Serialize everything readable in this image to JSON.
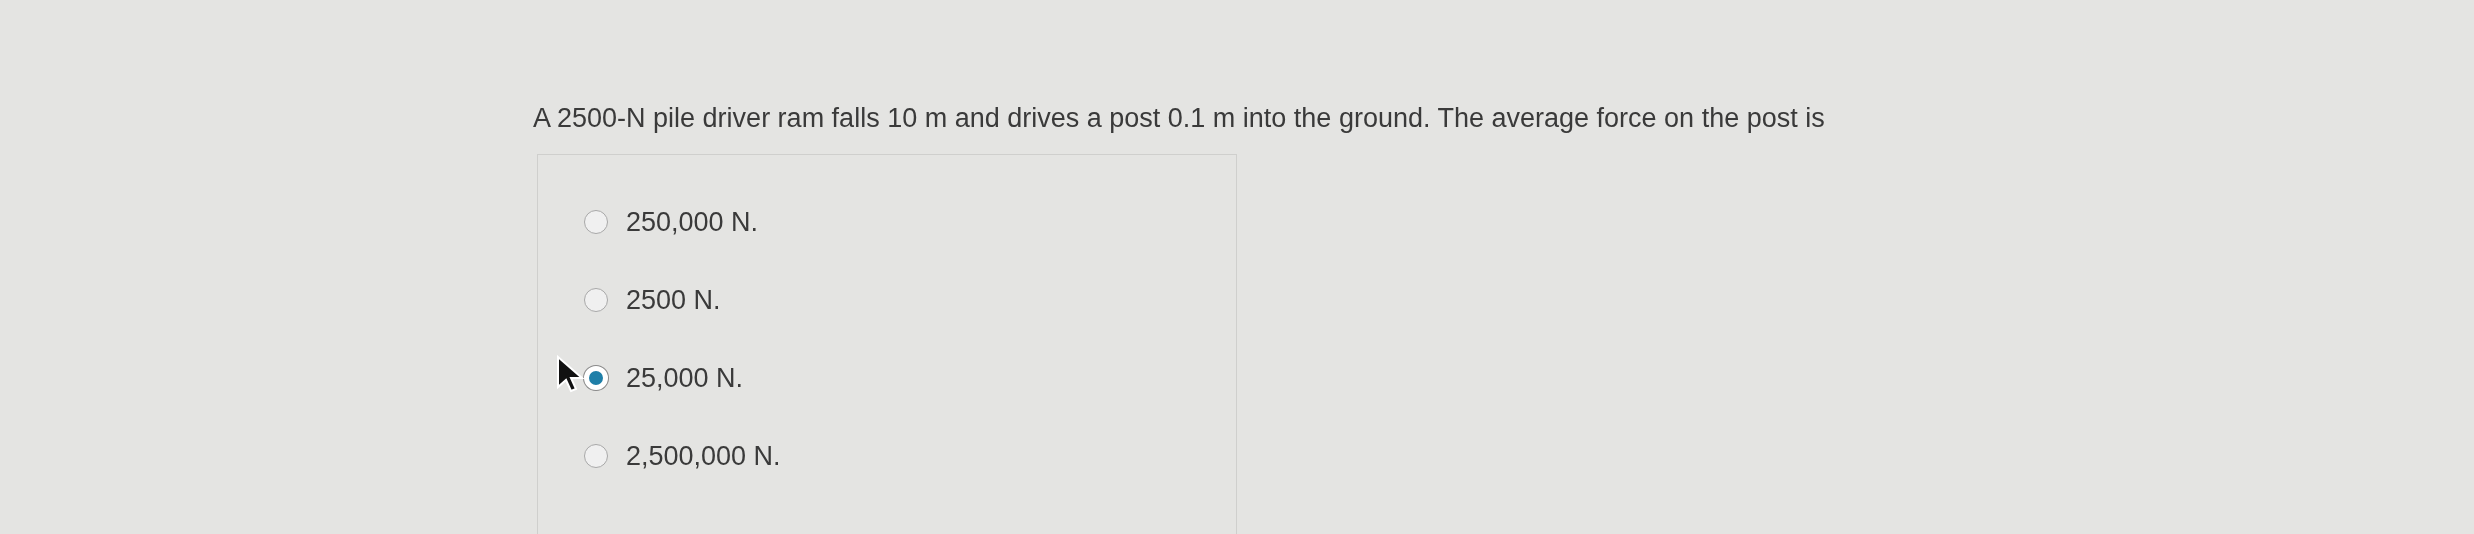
{
  "question": {
    "text": "A 2500-N pile driver ram falls 10 m and drives a post 0.1 m into the ground. The average force on the post is"
  },
  "options": [
    {
      "label": "250,000 N.",
      "selected": false
    },
    {
      "label": "2500 N.",
      "selected": false
    },
    {
      "label": "25,000 N.",
      "selected": true
    },
    {
      "label": "2,500,000 N.",
      "selected": false
    }
  ]
}
